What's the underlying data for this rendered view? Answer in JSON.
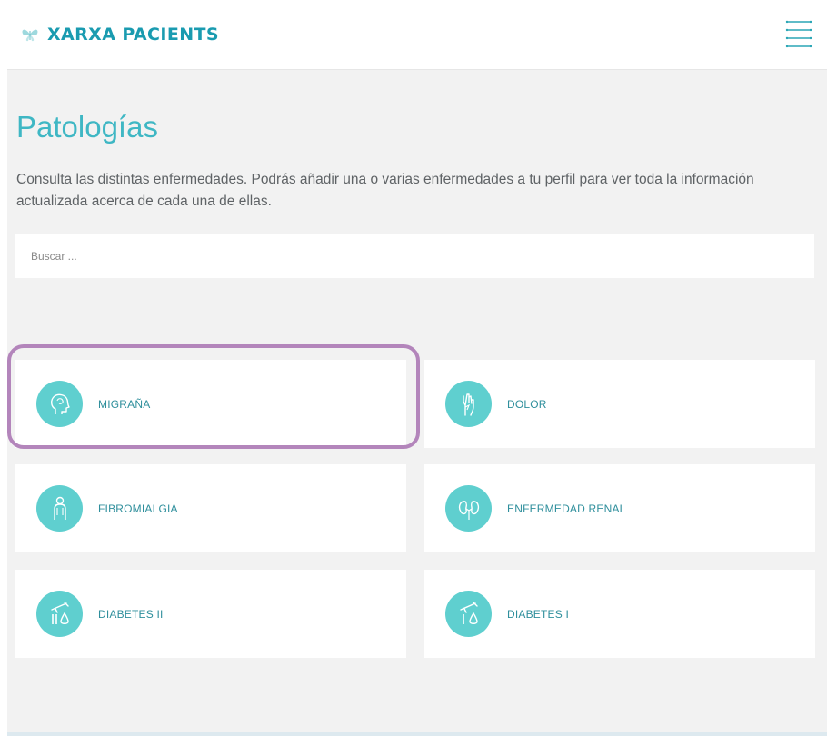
{
  "header": {
    "brand": "XARXA PACIENTS",
    "logo_icon": "butterfly-icon",
    "menu_icon": "hamburger-menu-icon"
  },
  "page": {
    "title": "Patologías",
    "intro": "Consulta las distintas enfermedades. Podrás añadir una o varias enfermedades a tu perfil para ver toda la información actualizada acerca de cada una de ellas."
  },
  "search": {
    "placeholder": "Buscar ...",
    "value": ""
  },
  "pathologies": [
    {
      "label": "MIGRAÑA",
      "icon": "head-icon"
    },
    {
      "label": "DOLOR",
      "icon": "hand-icon"
    },
    {
      "label": "FIBROMIALGIA",
      "icon": "body-icon"
    },
    {
      "label": "ENFERMEDAD RENAL",
      "icon": "kidney-icon"
    },
    {
      "label": "DIABETES II",
      "icon": "syringe-drop-icon"
    },
    {
      "label": "DIABETES I",
      "icon": "syringe-drop-icon"
    }
  ],
  "colors": {
    "brand": "#1a9bb0",
    "title": "#3fb7c4",
    "icon_circle": "#5fcfcf",
    "label": "#2f8f9c",
    "background": "#f2f2f2",
    "highlight": "#b385bb"
  }
}
